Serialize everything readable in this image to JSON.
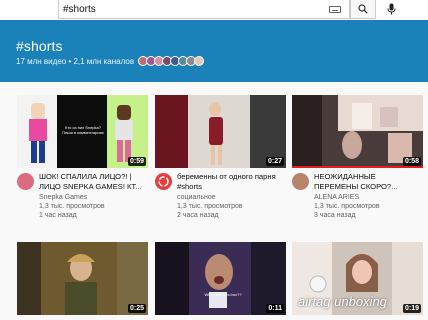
{
  "search": {
    "query": "#shorts"
  },
  "banner": {
    "title": "#shorts",
    "stats": "17 млн видео • 2,1 млн каналов",
    "avatar_colors": [
      "#c46a74",
      "#9b5b8f",
      "#d98fa0",
      "#7a4a6b",
      "#3f5c8a",
      "#5a8d9c",
      "#8a8a8a",
      "#e0c9b2"
    ]
  },
  "videos": [
    {
      "title_l1": "ШОК! СПАЛИЛА ЛИЦО?! |",
      "title_l2": "ЛИЦО SNEPKA GAMES! КТ...",
      "channel": "Snepka Games",
      "views": "1,3 тыс. просмотров",
      "age": "1 час назад",
      "duration": "0:59",
      "thumb_text": "Кто из них Snepka?\nПиши в комментариях"
    },
    {
      "title_l1": "беременны от одного парня",
      "title_l2": "#shorts",
      "channel": "социальное",
      "views": "1,3 тыс. просмотров",
      "age": "2 часа назад",
      "duration": "0:27"
    },
    {
      "title_l1": "НЕОЖИДАННЫЕ",
      "title_l2": "ПЕРЕМЕНЫ СКОРО?...",
      "channel": "ALENA ARIES",
      "views": "1,3 тыс. просмотров",
      "age": "3 часа назад",
      "duration": "0:58"
    },
    {
      "duration": "0:25"
    },
    {
      "duration": "0:11",
      "thumb_text": "What is in this box??"
    },
    {
      "duration": "0:19",
      "thumb_text": "airtag unboxing"
    }
  ],
  "colors": {
    "banner": "#1a82b8",
    "progress": "#e02020"
  }
}
